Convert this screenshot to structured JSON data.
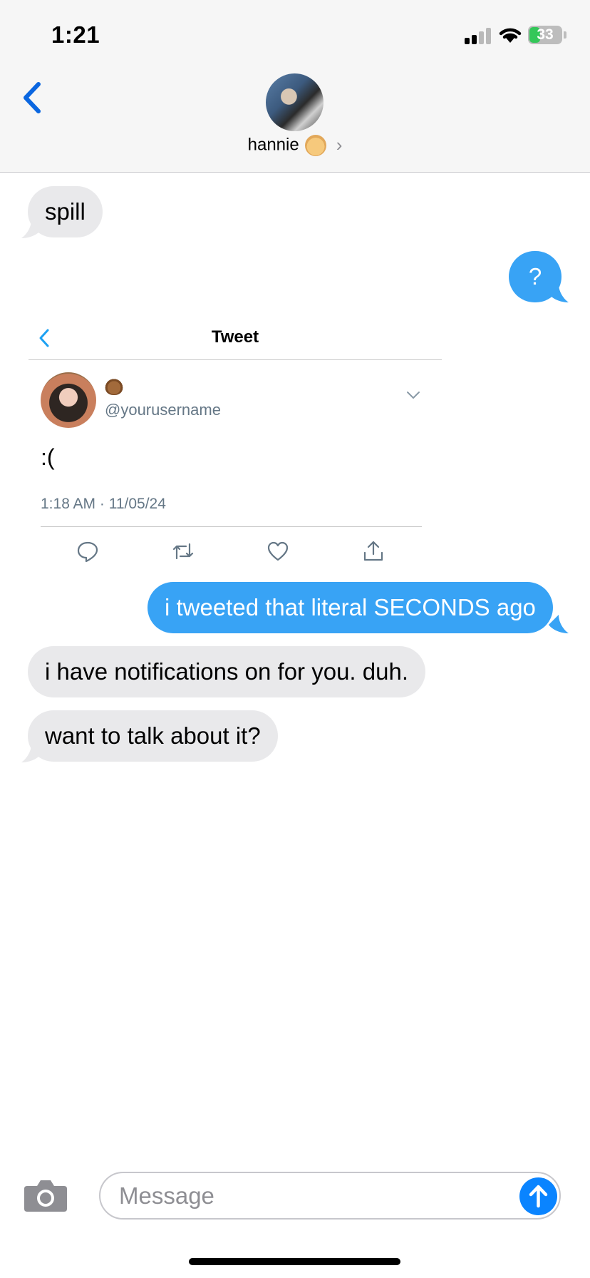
{
  "status_bar": {
    "time": "1:21",
    "battery": "33"
  },
  "header": {
    "contact_name": "hannie",
    "contact_emoji": "👼",
    "chevron": "›"
  },
  "messages": [
    {
      "text": "spill",
      "direction": "incoming"
    },
    {
      "text": "?",
      "direction": "outgoing"
    },
    {
      "text": "i tweeted that literal SECONDS ago",
      "direction": "outgoing"
    },
    {
      "text": "i have notifications on for you. duh.",
      "direction": "incoming"
    },
    {
      "text": "want to talk about it?",
      "direction": "incoming"
    }
  ],
  "tweet": {
    "title": "Tweet",
    "display_emoji": "🧸",
    "handle": "@yourusername",
    "text": ":(",
    "meta": "1:18 AM · 11/05/24",
    "accent": "#1da1f2",
    "icons": [
      "back-chevron-icon",
      "caret-down-icon",
      "reply-icon",
      "retweet-icon",
      "like-icon",
      "share-icon"
    ]
  },
  "composer": {
    "placeholder": "Message"
  },
  "colors": {
    "incoming_bubble": "#e9e9eb",
    "outgoing_bubble": "#38a3f5",
    "ios_blue": "#0a84ff",
    "battery_green": "#34c759"
  }
}
